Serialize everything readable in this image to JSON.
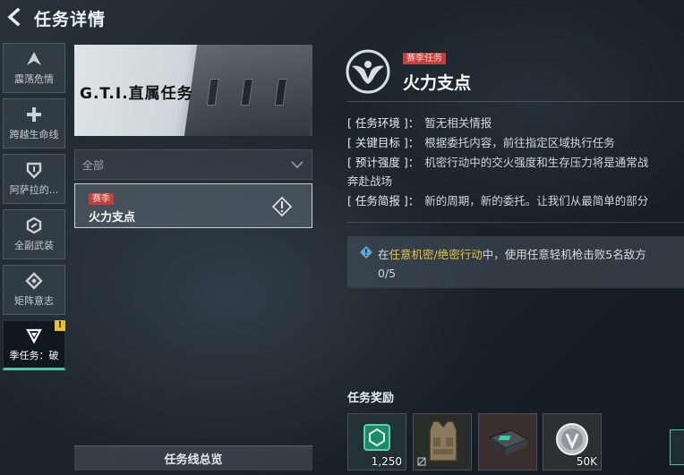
{
  "header": {
    "title": "任务详情"
  },
  "sidebar": {
    "items": [
      {
        "label": "震荡危情",
        "icon": "delta-icon"
      },
      {
        "label": "跨越生命线",
        "icon": "cross-icon"
      },
      {
        "label": "阿萨拉的...",
        "icon": "shield-icon"
      },
      {
        "label": "全副武装",
        "icon": "hex-icon"
      },
      {
        "label": "矩阵意志",
        "icon": "diamond-icon"
      },
      {
        "label": "季任务：破",
        "icon": "triangle-icon",
        "active": true,
        "badge": "!"
      }
    ]
  },
  "banner": {
    "title": "G.T.I.直属任务"
  },
  "filter": {
    "selected": "全部"
  },
  "mission_list": [
    {
      "tag": "赛季",
      "name": "火力支点"
    }
  ],
  "overview_button": "任务线总览",
  "detail": {
    "tag": "赛季任务",
    "title": "火力支点",
    "info": [
      {
        "key": "[ 任务环境 ]：",
        "value": "暂无相关情报"
      },
      {
        "key": "[ 关键目标 ]：",
        "value": "根据委托内容，前往指定区域执行任务"
      },
      {
        "key": "[ 预计强度 ]：",
        "value": "机密行动中的交火强度和生存压力将是通常战"
      },
      {
        "key": "",
        "value": "奔赴战场"
      },
      {
        "key": "[ 任务简报 ]：",
        "value": "新的周期，新的委托。让我们从最简单的部分"
      }
    ],
    "objective": {
      "prefix": "在",
      "highlight": "任意机密/绝密行动",
      "suffix": "中，使用任意轻机枪击败5名敌方",
      "progress": "0/5"
    }
  },
  "rewards": {
    "title": "任务奖励",
    "items": [
      {
        "name": "reward-token",
        "qty": "1,250"
      },
      {
        "name": "reward-vest",
        "qty": ""
      },
      {
        "name": "reward-case",
        "qty": ""
      },
      {
        "name": "reward-coin",
        "qty": "50K"
      }
    ]
  },
  "colors": {
    "accent": "#4ec7a0",
    "tag_red": "#c2403c",
    "highlight": "#e6c24a"
  }
}
